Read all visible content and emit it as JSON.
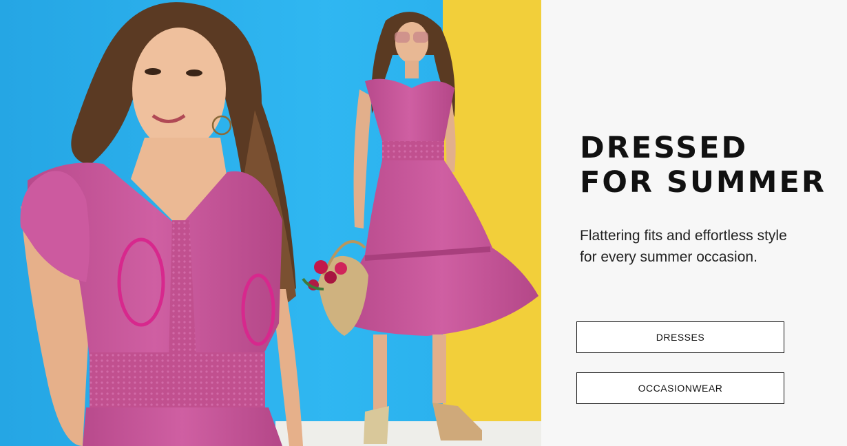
{
  "banner": {
    "headline_line1": "DRESSED",
    "headline_line2": "FOR SUMMER",
    "subtext_line1": "Flattering fits and effortless style",
    "subtext_line2": "for every summer occasion.",
    "buttons": [
      {
        "label": "DRESSES"
      },
      {
        "label": "OCCASIONWEAR"
      }
    ]
  },
  "colors": {
    "backdrop_blue": "#2bb2ef",
    "backdrop_yellow": "#f2cf3a",
    "dress_pink": "#c8559a",
    "panel_background": "#f7f7f7",
    "text": "#111111"
  }
}
